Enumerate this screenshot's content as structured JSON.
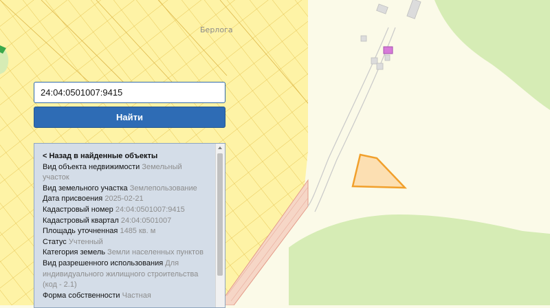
{
  "map": {
    "place_label": "Берлога",
    "colors": {
      "background": "#fbfae8",
      "settlement_fill": "#fef3a6",
      "parcel_lines": "#e8c85a",
      "forest": "#d6ecb5",
      "highlight_parcel_fill": "#fcd9a8",
      "highlight_parcel_stroke": "#f1a02c",
      "road": "#c9c9c9"
    }
  },
  "search": {
    "value": "24:04:0501007:9415",
    "button_label": "Найти"
  },
  "info": {
    "back_link": "< Назад в найденные объекты",
    "rows": [
      {
        "label": "Вид объекта недвижимости",
        "value": "Земельный участок"
      },
      {
        "label": "Вид земельного участка",
        "value": "Землепользование"
      },
      {
        "label": "Дата присвоения",
        "value": "2025-02-21"
      },
      {
        "label": "Кадастровый номер",
        "value": "24:04:0501007:9415"
      },
      {
        "label": "Кадастровый квартал",
        "value": "24:04:0501007"
      },
      {
        "label": "Площадь уточненная",
        "value": "1485 кв. м"
      },
      {
        "label": "Статус",
        "value": "Учтенный"
      },
      {
        "label": "Категория земель",
        "value": "Земли населенных пунктов"
      },
      {
        "label": "Вид разрешенного использования",
        "value": "Для индивидуального жилищного строительства (код - 2.1)"
      },
      {
        "label": "Форма собственности",
        "value": "Частная"
      }
    ]
  }
}
